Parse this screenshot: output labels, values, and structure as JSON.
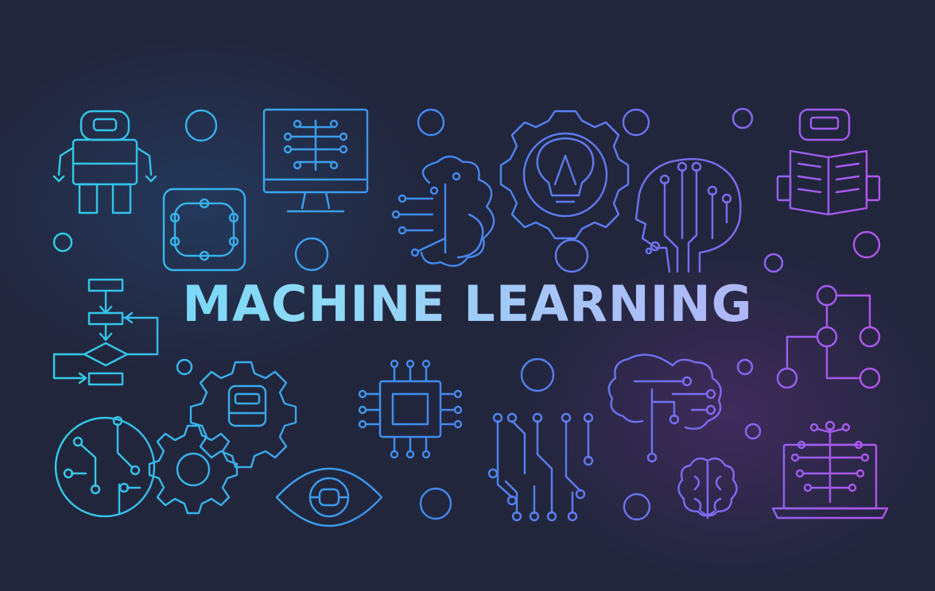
{
  "banner": {
    "title": "MACHINE LEARNING",
    "colors": {
      "background": "#22263d",
      "cyan": "#2fd8e6",
      "blue": "#3f8cf0",
      "violet": "#8a63ee",
      "magenta": "#c64ef0"
    },
    "icons": [
      "robot-icon",
      "circuit-square-icon",
      "monitor-neural-icon",
      "brain-circuit-icon",
      "lightbulb-gear-icon",
      "ai-head-icon",
      "robot-reading-book-icon",
      "flowchart-icon",
      "robot-gear-icon",
      "cpu-chip-icon",
      "circuit-traces-icon",
      "brain-tree-icon",
      "node-graph-icon",
      "circuit-globe-icon",
      "gear-icon",
      "eye-icon",
      "small-brain-icon",
      "laptop-neural-icon"
    ]
  }
}
